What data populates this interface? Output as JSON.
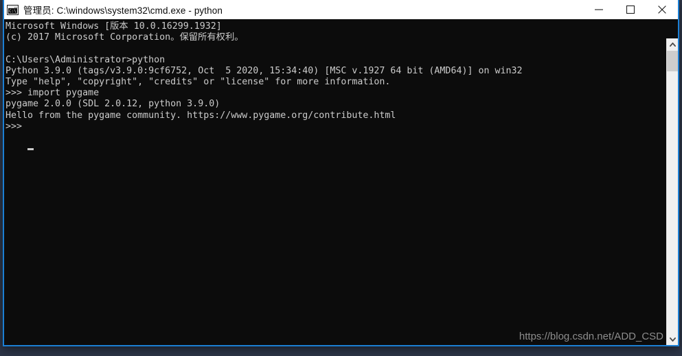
{
  "window": {
    "title": "管理员: C:\\windows\\system32\\cmd.exe - python",
    "icon": "cmd-console-icon",
    "icon_text": "C:\\_",
    "accent_color": "#1b7fd4",
    "titlebar_background": "#ffffff",
    "console_background": "#0c0c0c",
    "console_foreground": "#cccccc"
  },
  "controls": {
    "minimize_label": "最小化",
    "maximize_label": "最大化",
    "close_label": "关闭"
  },
  "console": {
    "lines": [
      "Microsoft Windows [版本 10.0.16299.1932]",
      "(c) 2017 Microsoft Corporation。保留所有权利。",
      "",
      "C:\\Users\\Administrator>python",
      "Python 3.9.0 (tags/v3.9.0:9cf6752, Oct  5 2020, 15:34:40) [MSC v.1927 64 bit (AMD64)] on win32",
      "Type \"help\", \"copyright\", \"credits\" or \"license\" for more information.",
      ">>> import pygame",
      "pygame 2.0.0 (SDL 2.0.12, python 3.9.0)",
      "Hello from the pygame community. https://www.pygame.org/contribute.html",
      ">>> "
    ],
    "text": "Microsoft Windows [版本 10.0.16299.1932]\n(c) 2017 Microsoft Corporation。保留所有权利。\n\nC:\\Users\\Administrator>python\nPython 3.9.0 (tags/v3.9.0:9cf6752, Oct  5 2020, 15:34:40) [MSC v.1927 64 bit (AMD64)] on win32\nType \"help\", \"copyright\", \"credits\" or \"license\" for more information.\n>>> import pygame\npygame 2.0.0 (SDL 2.0.12, python 3.9.0)\nHello from the pygame community. https://www.pygame.org/contribute.html\n>>> ",
    "prompt": ">>>",
    "cursor": "_"
  },
  "watermark": {
    "text": "https://blog.csdn.net/ADD_CSD",
    "color": "#8d8d8d"
  },
  "scrollbar": {
    "up_arrow": "chevron-up",
    "down_arrow": "chevron-down",
    "thumb_color": "#cdcdcd",
    "track_color": "#f0f0f0"
  }
}
